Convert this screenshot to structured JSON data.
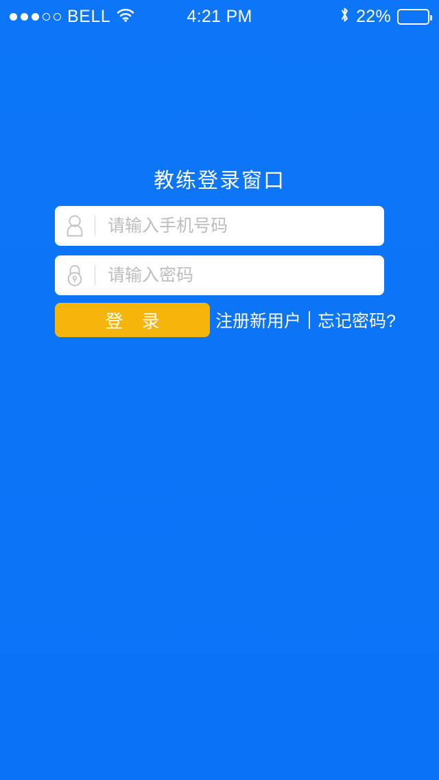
{
  "theme": {
    "background_blue": "#0b74f7",
    "button_amber": "#f5b40a",
    "field_white": "#ffffff",
    "placeholder_gray": "#bdbdbd"
  },
  "status_bar": {
    "signal_dots_filled": 3,
    "signal_dots_total": 5,
    "carrier": "BELL",
    "wifi_icon": "wifi-icon",
    "time": "4:21 PM",
    "bluetooth_icon": "bluetooth-icon",
    "battery_percent_label": "22%",
    "battery_level": 22
  },
  "login": {
    "title": "教练登录窗口",
    "username": {
      "icon": "user-icon",
      "placeholder": "请输入手机号码",
      "value": ""
    },
    "password": {
      "icon": "lock-icon",
      "placeholder": "请输入密码",
      "value": ""
    },
    "submit_label": "登 录",
    "register_label": "注册新用户",
    "forgot_label": "忘记密码?"
  }
}
